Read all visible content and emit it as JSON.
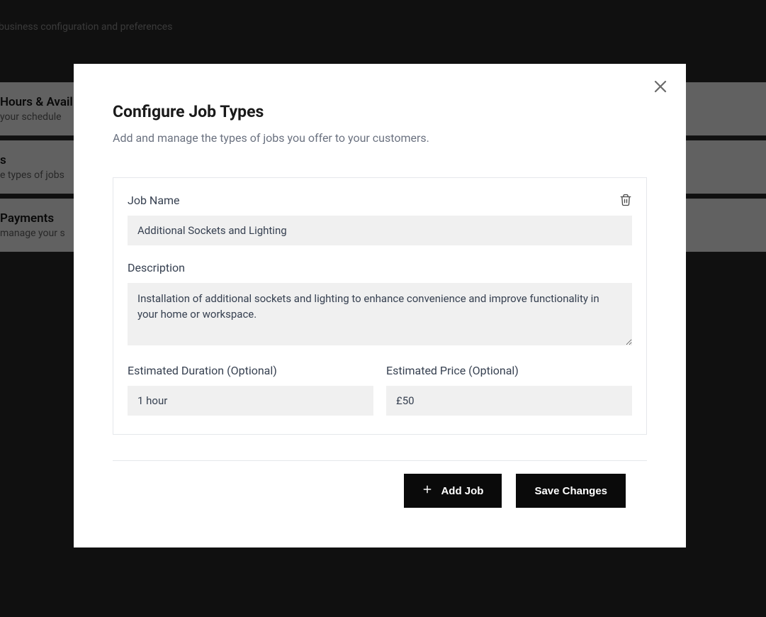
{
  "background": {
    "tagline": "business configuration and preferences",
    "rows": [
      {
        "title": "Hours & Avail",
        "sub": "your schedule"
      },
      {
        "title": "s",
        "sub": "e types of jobs"
      },
      {
        "title": "Payments",
        "sub": "manage your s"
      }
    ]
  },
  "modal": {
    "title": "Configure Job Types",
    "subtitle": "Add and manage the types of jobs you offer to your customers.",
    "job": {
      "name_label": "Job Name",
      "name_value": "Additional Sockets and Lighting",
      "desc_label": "Description",
      "desc_value": "Installation of additional sockets and lighting to enhance convenience and improve functionality in your home or workspace.",
      "duration_label": "Estimated Duration (Optional)",
      "duration_value": "1 hour",
      "price_label": "Estimated Price (Optional)",
      "price_value": "£50"
    },
    "buttons": {
      "add": "Add Job",
      "save": "Save Changes"
    }
  }
}
